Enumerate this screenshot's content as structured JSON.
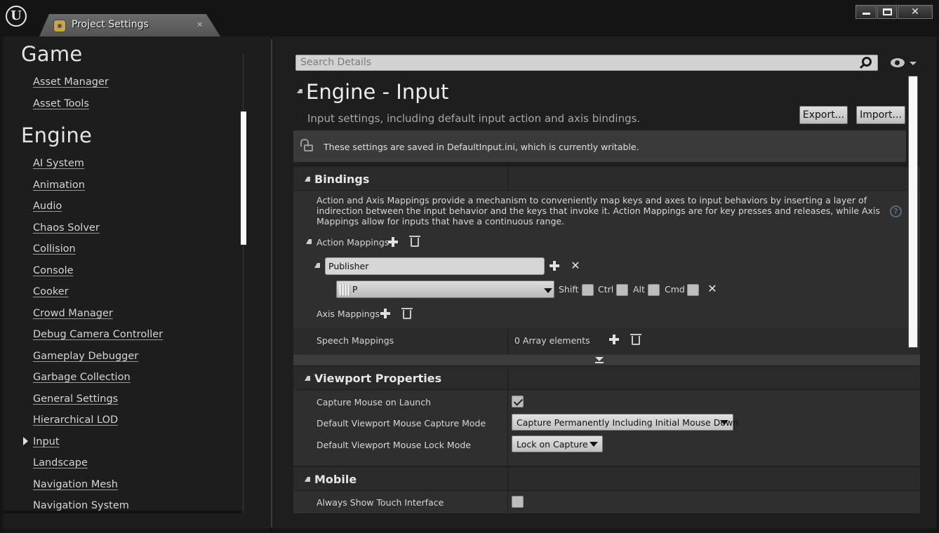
{
  "window": {
    "tab_title": "Project Settings",
    "tab_close": "×",
    "close_glyph": "✕"
  },
  "nav": {
    "heading_game": "Game",
    "game_items": [
      "Asset Manager",
      "Asset Tools"
    ],
    "heading_engine": "Engine",
    "engine_items": [
      "AI System",
      "Animation",
      "Audio",
      "Chaos Solver",
      "Collision",
      "Console",
      "Cooker",
      "Crowd Manager",
      "Debug Camera Controller",
      "Gameplay Debugger",
      "Garbage Collection",
      "General Settings",
      "Hierarchical LOD",
      "Input",
      "Landscape",
      "Navigation Mesh",
      "Navigation System"
    ],
    "selected": "Input"
  },
  "details": {
    "search_placeholder": "Search Details",
    "page_title": "Engine - Input",
    "page_desc": "Input settings, including default input action and axis bindings.",
    "export_label": "Export...",
    "import_label": "Import...",
    "notice": "These settings are saved in DefaultInput.ini, which is currently writable."
  },
  "bindings": {
    "title": "Bindings",
    "description": "Action and Axis Mappings provide a mechanism to conveniently map keys and axes to input behaviors by inserting a layer of indirection between the input behavior and the keys that invoke it. Action Mappings are for key presses and releases, while Axis Mappings allow for inputs that have a continuous range.",
    "help": "?",
    "action_mappings_label": "Action Mappings",
    "action_name": "Publisher",
    "key_value": "P",
    "modifiers": [
      "Shift",
      "Ctrl",
      "Alt",
      "Cmd"
    ],
    "axis_mappings_label": "Axis Mappings",
    "speech_mappings_label": "Speech Mappings",
    "speech_value": "0 Array elements",
    "x_glyph": "✕"
  },
  "viewport": {
    "title": "Viewport Properties",
    "capture_mouse_label": "Capture Mouse on Launch",
    "capture_mouse_checked": true,
    "capture_mode_label": "Default Viewport Mouse Capture Mode",
    "capture_mode_value": "Capture Permanently Including Initial Mouse Down",
    "lock_mode_label": "Default Viewport Mouse Lock Mode",
    "lock_mode_value": "Lock on Capture"
  },
  "mobile": {
    "title": "Mobile",
    "touch_label": "Always Show Touch Interface",
    "touch_checked": false
  }
}
